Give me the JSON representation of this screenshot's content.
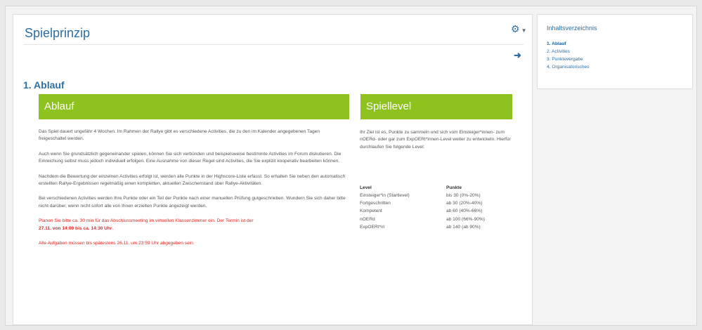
{
  "page": {
    "title": "Spielprinzip"
  },
  "section": {
    "title": "1. Ablauf"
  },
  "ablauf": {
    "heading": "Ablauf",
    "paragraphs": [
      "Das Spiel dauert ungefähr 4 Wochen. Im Rahmen der Rallye gibt es verschiedene Activities, die zu den im Kalender angegebenen Tagen freigeschaltet werden.",
      "Auch wenn Sie grundsätzlich gegeneinander spielen, können Sie sich verbünden und beispielsweise bestimmte Activities im Forum diskutieren. Die Einreichung selbst muss jedoch individuell erfolgen. Eine Ausnahme von dieser Regel sind Activities, die Sie explizit kooperativ bearbeiten können.",
      "Nachdem die Bewertung der einzelnen Activities erfolgt ist, werden alle Punkte in der Highscore-Liste erfasst. So erhalten Sie neben den automatisch erstellten Rallye-Ergebnissen regelmäßig einen kompletten, aktuellen Zwischenstand über Rallye-Aktivitäten.",
      "Bei verschiedenen Activities werden Ihre Punkte oder ein Teil der Punkte nach einer manuellen Prüfung gutgeschrieben. Wundern Sie sich daher bitte nicht darüber, wenn nicht sofort alle von Ihnen erzielten Punkte angezeigt werden."
    ],
    "notice_text": "Planen Sie bitte ca. 30 min für das Abschlussmeeting im virtuellen Klassenzimmer ein. Der Termin ist der",
    "notice_date": "27.11. von 14:00 bis ca. 14:30 Uhr",
    "notice_end": ".",
    "deadline": "Alle Aufgaben müssen bis spätestens 26.11. um 23:59 Uhr abgegeben sein."
  },
  "spiellevel": {
    "heading": "Spiellevel",
    "intro": "Ihr Ziel ist es, Punkte zu sammeln und sich vom Einsteiger*innen- zum nOERd- oder gar zum ExpOERt*innen-Level weiter zu entwickeln. Hierfür durchlaufen Sie folgende Level:",
    "col_level": "Level",
    "col_points": "Punkte",
    "rows": [
      {
        "level": "Einsteiger*in (Startlevel)",
        "points": "bis 30 (0%-20%)"
      },
      {
        "level": "Fortgeschritten",
        "points": "ab 30 (20%-40%)"
      },
      {
        "level": "Kompetent",
        "points": "ab 60 (40%-66%)"
      },
      {
        "level": "nOERd",
        "points": "ab 100 (66%-90%)"
      },
      {
        "level": "ExpOERt*in",
        "points": "ab 140 (ab 90%)"
      }
    ]
  },
  "toc": {
    "title": "Inhaltsverzeichnis",
    "items": [
      "1. Ablauf",
      "2. Activities",
      "3. Punktevergabe",
      "4. Organisatorisches"
    ]
  },
  "colors": {
    "accent": "#8dc21f",
    "link": "#2d6fa3",
    "alert": "#e0261f"
  },
  "icons": {
    "settings": "gear-icon",
    "next": "arrow-right-icon"
  }
}
